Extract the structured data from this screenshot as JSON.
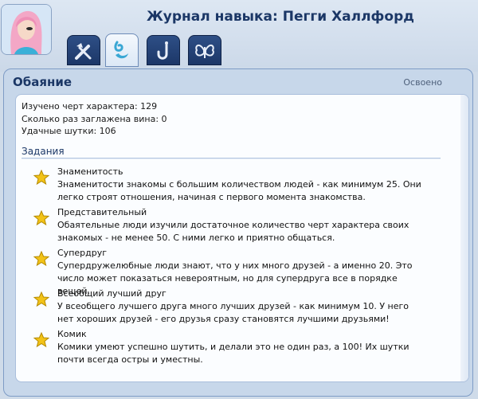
{
  "window": {
    "title": "Журнал навыка: Пегги Халлфорд"
  },
  "tabs": [
    {
      "id": "skills",
      "icon": "tools-icon",
      "active": false
    },
    {
      "id": "charm",
      "icon": "charisma-icon",
      "active": true
    },
    {
      "id": "fishing",
      "icon": "fishing-hook-icon",
      "active": false
    },
    {
      "id": "collection",
      "icon": "butterfly-icon",
      "active": false
    }
  ],
  "panel": {
    "title": "Обаяние",
    "status": "Освоено"
  },
  "stats": [
    "Изучено черт характера: 129",
    "Сколько раз заглажена вина: 0",
    "Удачные шутки: 106"
  ],
  "tasks_section": {
    "title": "Задания",
    "items": [
      {
        "name": "Знаменитость",
        "desc_lines": [
          "Знаменитости знакомы с большим количеством людей - как минимум 25. Они",
          "легко строят отношения, начиная с первого момента знакомства."
        ]
      },
      {
        "name": "Представительный",
        "desc_lines": [
          "Обаятельные люди изучили достаточное количество черт характера своих",
          "знакомых - не менее 50. С ними легко и приятно общаться."
        ]
      },
      {
        "name": "Супердруг",
        "desc_lines": [
          "Супердружелюбные люди знают, что у них много друзей - а именно 20. Это",
          "число может показаться невероятным, но для супердруга все в порядке вещей."
        ]
      },
      {
        "name": "Всеобщий лучший друг",
        "desc_lines": [
          "У всеобщего лучшего друга много лучших друзей - как минимум 10. У него",
          "нет хороших друзей - его друзья сразу становятся лучшими друзьями!"
        ]
      },
      {
        "name": "Комик",
        "desc_lines": [
          "Комики умеют успешно шутить, и делали это не один раз, а 100! Их шутки",
          "почти всегда остры и уместны."
        ]
      }
    ]
  },
  "colors": {
    "accent": "#1b3766",
    "star": "#f2c318"
  }
}
